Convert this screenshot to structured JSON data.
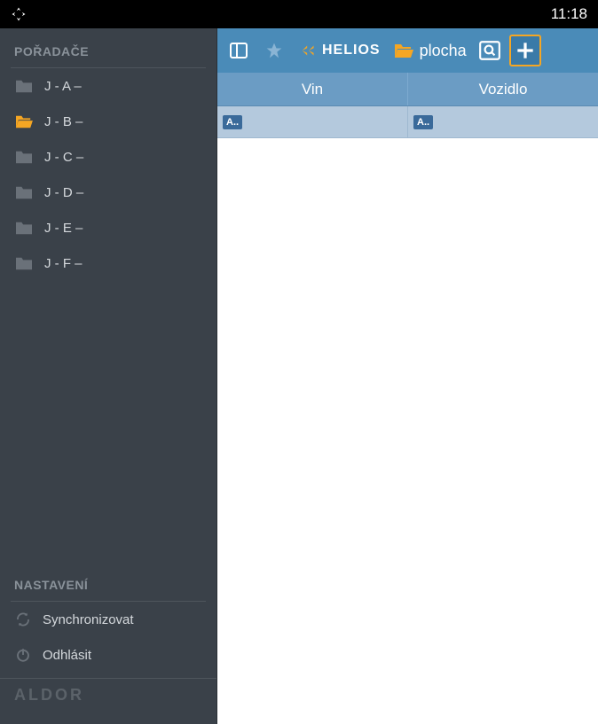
{
  "statusbar": {
    "time": "11:18"
  },
  "sidebar": {
    "folders_header": "POŘADAČE",
    "items": [
      {
        "label": "J - A –",
        "active": false
      },
      {
        "label": "J - B –",
        "active": true
      },
      {
        "label": "J - C –",
        "active": false
      },
      {
        "label": "J - D –",
        "active": false
      },
      {
        "label": "J - E –",
        "active": false
      },
      {
        "label": "J - F –",
        "active": false
      }
    ],
    "settings_header": "NASTAVENÍ",
    "actions": {
      "sync": "Synchronizovat",
      "logout": "Odhlásit"
    },
    "brand": "ALDOR"
  },
  "toolbar": {
    "logo_text": "HELIOS",
    "path_label": "plocha"
  },
  "table": {
    "headers": [
      "Vin",
      "Vozidlo"
    ],
    "rows": [
      {
        "vin": "A..",
        "vozidlo": "A.."
      }
    ]
  }
}
